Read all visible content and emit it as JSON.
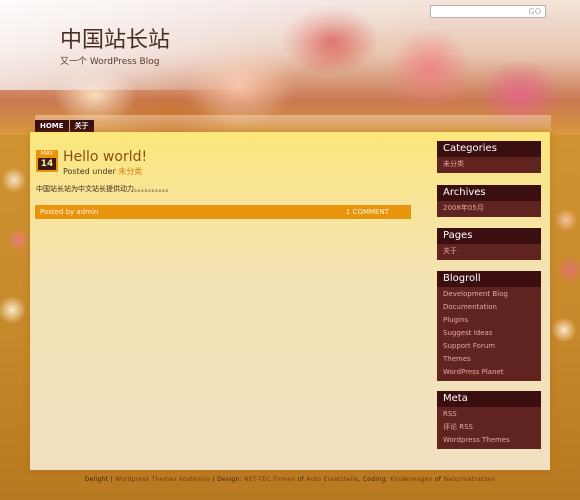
{
  "header": {
    "site_title": "中国站长站",
    "site_description": "又一个 WordPress Blog",
    "search_button": "GO"
  },
  "nav": {
    "items": [
      "HOME",
      "关于"
    ]
  },
  "post": {
    "date_month": "MAY",
    "date_day": "14",
    "title": "Hello world!",
    "meta_prefix": "Posted under",
    "category": "未分类",
    "body": "中国站长站为中文站长提供动力。。。。。。。。。。",
    "posted_by": "Posted by admin",
    "comments": "1 COMMENT"
  },
  "sidebar": {
    "categories": {
      "title": "Categories",
      "items": [
        "未分类"
      ]
    },
    "archives": {
      "title": "Archives",
      "items": [
        "2008年05月"
      ]
    },
    "pages": {
      "title": "Pages",
      "items": [
        "关于"
      ]
    },
    "blogroll": {
      "title": "Blogroll",
      "items": [
        "Development Blog",
        "Documentation",
        "Plugins",
        "Suggest Ideas",
        "Support Forum",
        "Themes",
        "WordPress Planet"
      ]
    },
    "meta": {
      "title": "Meta",
      "items": [
        "RSS",
        "评论 RSS",
        "Wordpress Themes"
      ]
    }
  },
  "footer": {
    "parts": [
      {
        "text": "Delight",
        "link": false
      },
      {
        "text": " | ",
        "link": false
      },
      {
        "text": "Wordpress Themes kostenlos",
        "link": true
      },
      {
        "text": " | Design: ",
        "link": false
      },
      {
        "text": "NET-TEC Firmen",
        "link": true
      },
      {
        "text": " of ",
        "link": false
      },
      {
        "text": "Auto Ersatzteile",
        "link": true
      },
      {
        "text": ", Coding: ",
        "link": false
      },
      {
        "text": "Kinderwagen",
        "link": true
      },
      {
        "text": " of ",
        "link": false
      },
      {
        "text": "Naturmatratzen",
        "link": true
      }
    ]
  },
  "colors": {
    "nav_bg": "#3b0f0f",
    "widget_title_bg": "#3b0f0f",
    "widget_body_bg": "#5f2320",
    "accent_orange": "#e8940c",
    "page_bg": "#d59a36"
  }
}
